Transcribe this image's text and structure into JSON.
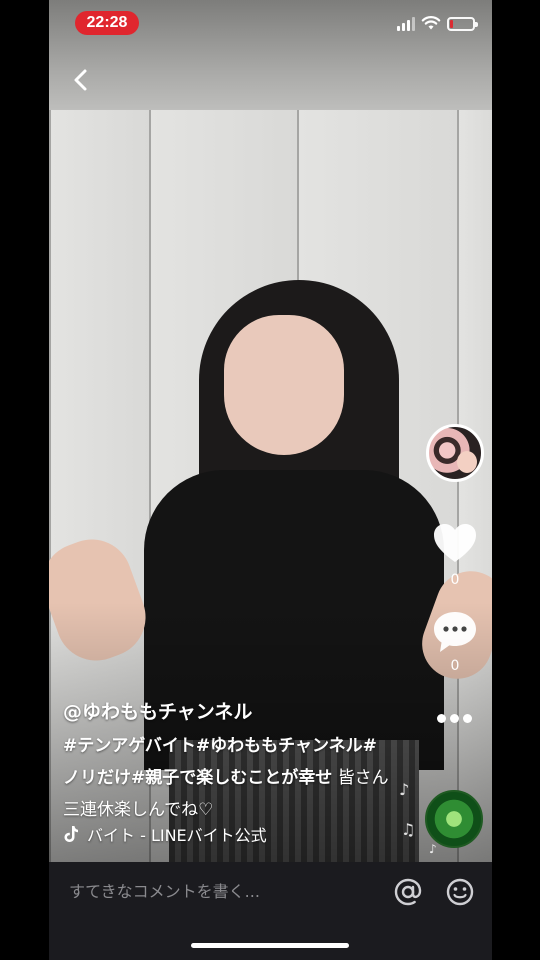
{
  "status_bar": {
    "time": "22:28",
    "battery_level": 0.15
  },
  "video": {
    "author": "@ゆわももチャンネル",
    "caption_tags": "#テンアゲバイト#ゆわももチャンネル#ノリだけ#親子で楽しむことが幸せ",
    "caption_text": " 皆さん三連休楽しんでね♡",
    "song": "バイト - LINEバイト公式"
  },
  "actions": {
    "like_count": "0",
    "comment_count": "0"
  },
  "comment_bar": {
    "placeholder": "すてきなコメントを書く..."
  },
  "icons": {
    "back": "chevron-left-icon",
    "like": "heart-icon",
    "comment": "speech-bubble-icon",
    "more": "ellipsis-icon",
    "at": "at-sign-icon",
    "emoji": "smiley-icon",
    "tiktok": "tiktok-note-icon"
  },
  "colors": {
    "time_pill": "#e0262e",
    "comment_bar": "#1b1b1f"
  }
}
